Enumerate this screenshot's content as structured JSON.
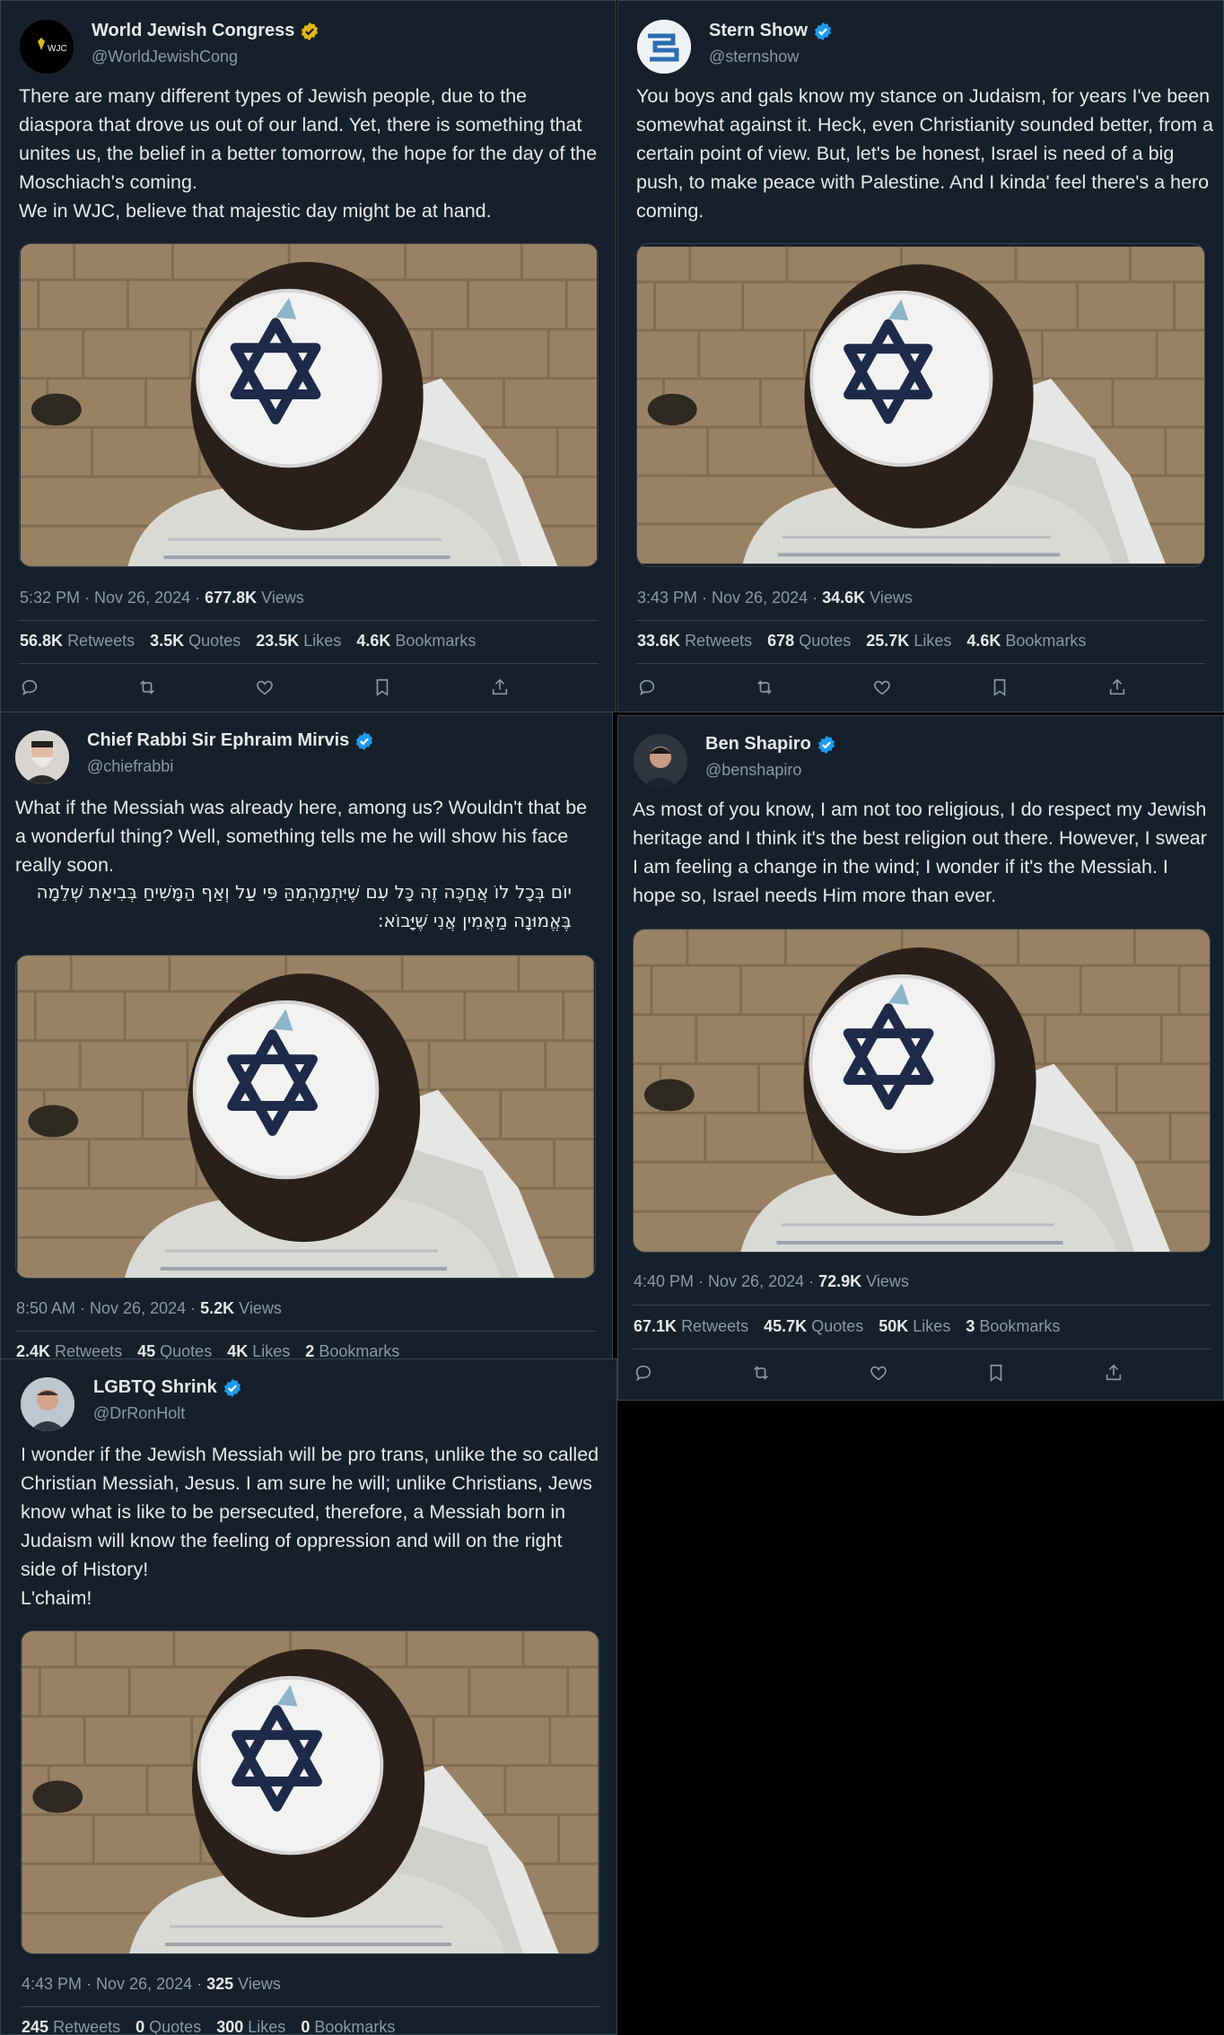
{
  "tweets": [
    {
      "name": "World Jewish Congress",
      "handle": "@WorldJewishCong",
      "badge": "gold",
      "avatar_text": "WJC",
      "text": "There are many different types of Jewish people, due to the diaspora that drove us out of our land. Yet, there is something that unites us, the belief in a better tomorrow, the hope for the day of the Moschiach's coming.\nWe in WJC, believe that majestic day might be at hand.",
      "hebrew": "",
      "time": "5:32 PM · Nov 26, 2024",
      "views_value": "677.8K",
      "views_label": "Views",
      "retweets": "56.8K",
      "retweets_label": "Retweets",
      "quotes": "3.5K",
      "quotes_label": "Quotes",
      "likes": "23.5K",
      "likes_label": "Likes",
      "bookmarks": "4.6K",
      "bookmarks_label": "Bookmarks"
    },
    {
      "name": "Stern Show",
      "handle": "@sternshow",
      "badge": "blue",
      "avatar_text": "",
      "text": "You boys and gals know my stance on Judaism, for years I've been somewhat against it. Heck, even Christianity sounded better, from a certain point of view. But, let's be honest, Israel is need of a big push, to make peace with Palestine. And I kinda' feel there's a hero coming.",
      "hebrew": "",
      "time": "3:43 PM · Nov 26, 2024",
      "views_value": "34.6K",
      "views_label": "Views",
      "retweets": "33.6K",
      "retweets_label": "Retweets",
      "quotes": "678",
      "quotes_label": "Quotes",
      "likes": "25.7K",
      "likes_label": "Likes",
      "bookmarks": "4.6K",
      "bookmarks_label": "Bookmarks"
    },
    {
      "name": "Chief Rabbi Sir Ephraim Mirvis",
      "handle": "@chiefrabbi",
      "badge": "blue",
      "avatar_text": "",
      "text": "What if the Messiah was already here, among us? Wouldn't that be a wonderful thing? Well, something tells me he will show his face really soon.",
      "hebrew": "יוֹם בְּכָל לוֹ אֲחַכֶּה זֶה כָּל עִם שֶׁיִּתְמַהְמֵהַּ פִּי עַל וְאַף הַמָּשִׁיחַ בְּבִיאַת שְׁלֵמָה בֶּאֱמוּנָה מַאֲמִין אֲנִי שֶׁיָּבוֹא:",
      "time": "8:50 AM · Nov 26, 2024",
      "views_value": "5.2K",
      "views_label": "Views",
      "retweets": "2.4K",
      "retweets_label": "Retweets",
      "quotes": "45",
      "quotes_label": "Quotes",
      "likes": "4K",
      "likes_label": "Likes",
      "bookmarks": "2",
      "bookmarks_label": "Bookmarks"
    },
    {
      "name": "Ben Shapiro",
      "handle": "@benshapiro",
      "badge": "blue",
      "avatar_text": "",
      "text": "As most of you know, I am not too religious, I do respect my Jewish heritage and I think it's the best religion out there. However, I swear I am feeling a change in the wind; I wonder if it's the Messiah. I hope so, Israel needs Him more than ever.",
      "hebrew": "",
      "time": "4:40 PM · Nov 26, 2024",
      "views_value": "72.9K",
      "views_label": "Views",
      "retweets": "67.1K",
      "retweets_label": "Retweets",
      "quotes": "45.7K",
      "quotes_label": "Quotes",
      "likes": "50K",
      "likes_label": "Likes",
      "bookmarks": "3",
      "bookmarks_label": "Bookmarks"
    },
    {
      "name": "LGBTQ Shrink",
      "handle": "@DrRonHolt",
      "badge": "blue",
      "avatar_text": "",
      "text": "I wonder if the Jewish Messiah will be pro trans, unlike the so called Christian Messiah, Jesus. I am sure he will; unlike Christians, Jews know what is like to be persecuted, therefore, a Messiah born in Judaism will know the feeling of oppression and will on the right side of History!\nL'chaim!",
      "hebrew": "",
      "time": "4:43 PM · Nov 26, 2024",
      "views_value": "325",
      "views_label": "Views",
      "retweets": "245",
      "retweets_label": "Retweets",
      "quotes": "0",
      "quotes_label": "Quotes",
      "likes": "300",
      "likes_label": "Likes",
      "bookmarks": "0",
      "bookmarks_label": "Bookmarks"
    }
  ],
  "icons": [
    "reply-icon",
    "retweet-icon",
    "like-icon",
    "bookmark-icon",
    "share-icon"
  ],
  "colors": {
    "background": "#15202b",
    "blue_badge": "#1d9bf0",
    "gold_badge": "#e2b719",
    "muted": "#8b98a5"
  }
}
